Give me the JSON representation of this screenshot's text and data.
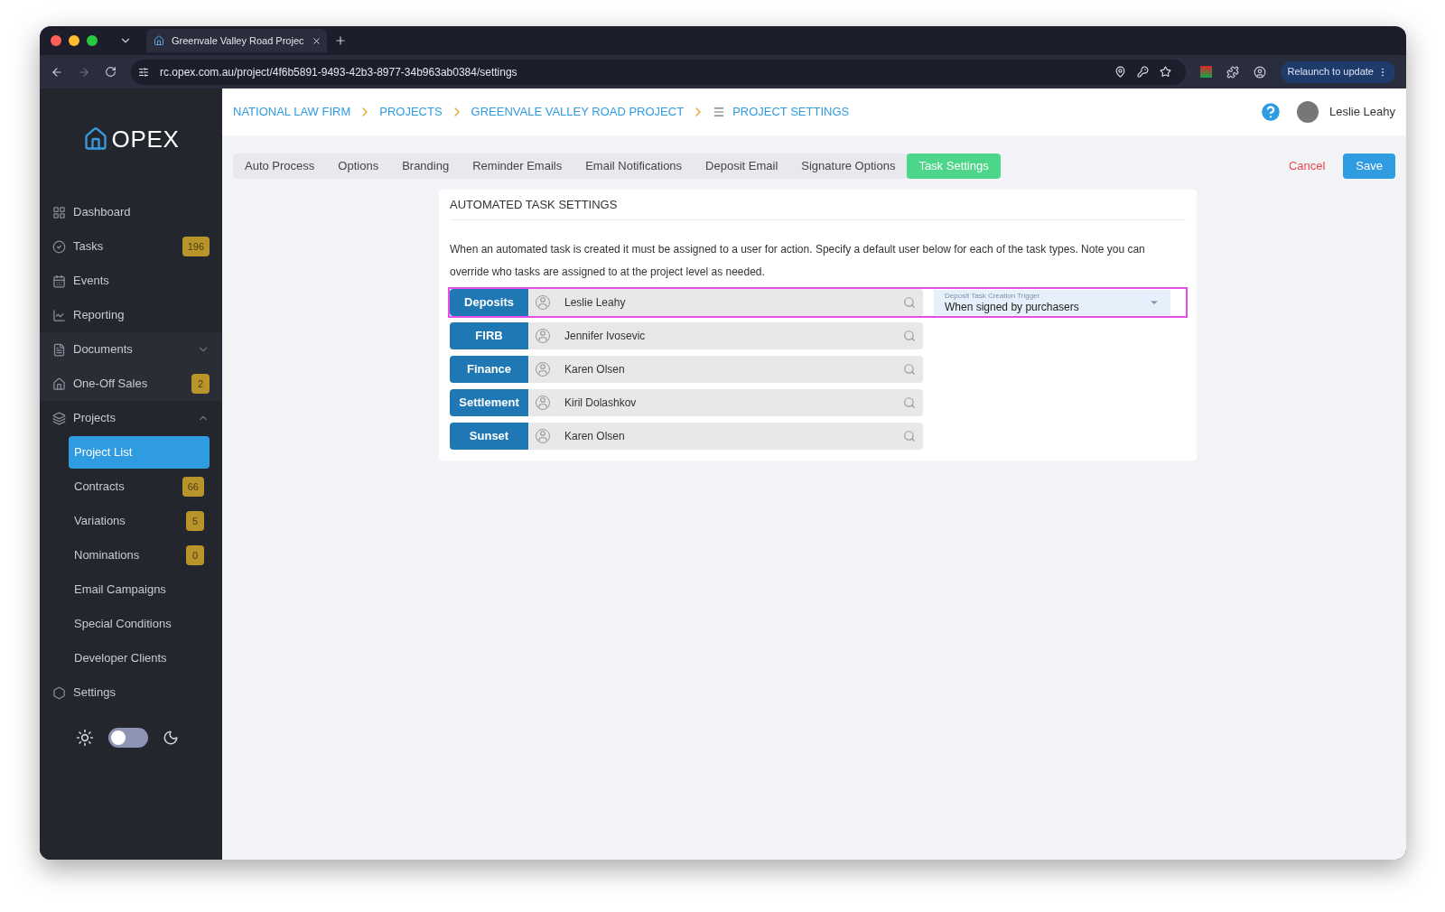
{
  "browser": {
    "tab_title": "Greenvale Valley Road Projec",
    "url": "rc.opex.com.au/project/4f6b5891-9493-42b3-8977-34b963ab0384/settings",
    "relaunch": "Relaunch to update"
  },
  "sidebar": {
    "logo": "OPEX",
    "items": [
      {
        "kind": "dashboard",
        "label": "Dashboard",
        "selected": false
      },
      {
        "kind": "tasks",
        "label": "Tasks",
        "badge": "196",
        "selected": false
      },
      {
        "kind": "events",
        "label": "Events",
        "selected": false
      },
      {
        "kind": "reporting",
        "label": "Reporting",
        "selected": false
      },
      {
        "kind": "documents",
        "label": "Documents",
        "expanded": false,
        "selected": false
      },
      {
        "kind": "sales",
        "label": "One-Off Sales",
        "badge": "2",
        "selected": false
      },
      {
        "kind": "projects",
        "label": "Projects",
        "expanded": true,
        "selected": false,
        "children": [
          {
            "label": "Project List",
            "selected": true
          },
          {
            "label": "Contracts",
            "badge": "66",
            "selected": false
          },
          {
            "label": "Variations",
            "badge": "5",
            "selected": false
          },
          {
            "label": "Nominations",
            "badge": "0",
            "selected": false
          },
          {
            "label": "Email Campaigns",
            "selected": false
          },
          {
            "label": "Special Conditions",
            "selected": false
          },
          {
            "label": "Developer Clients",
            "selected": false
          }
        ]
      },
      {
        "kind": "settings",
        "label": "Settings",
        "selected": false
      }
    ],
    "dark_mode": false
  },
  "breadcrumbs": [
    "NATIONAL LAW FIRM",
    "PROJECTS",
    "GREENVALE VALLEY ROAD PROJECT",
    "PROJECT SETTINGS"
  ],
  "user": {
    "name": "Leslie Leahy"
  },
  "tabs": [
    {
      "label": "Auto Process",
      "selected": false
    },
    {
      "label": "Options",
      "selected": false
    },
    {
      "label": "Branding",
      "selected": false
    },
    {
      "label": "Reminder Emails",
      "selected": false
    },
    {
      "label": "Email Notifications",
      "selected": false
    },
    {
      "label": "Deposit Email",
      "selected": false
    },
    {
      "label": "Signature Options",
      "selected": false
    },
    {
      "label": "Task Settings",
      "selected": true
    }
  ],
  "actions": {
    "cancel": "Cancel",
    "save": "Save"
  },
  "panel": {
    "title": "AUTOMATED TASK SETTINGS",
    "description": "When an automated task is created it must be assigned to a user for action. Specify a default user below for each of the task types. Note you can override who tasks are assigned to at the project level as needed.",
    "rows": [
      {
        "label": "Deposits",
        "assignee": "Leslie Leahy",
        "highlighted": true,
        "trigger": {
          "label": "Deposit Task Creation Trigger",
          "value": "When signed by purchasers"
        }
      },
      {
        "label": "FIRB",
        "assignee": "Jennifer  Ivosevic",
        "highlighted": false
      },
      {
        "label": "Finance",
        "assignee": "Karen Olsen",
        "highlighted": false
      },
      {
        "label": "Settlement",
        "assignee": "Kiril Dolashkov",
        "highlighted": false
      },
      {
        "label": "Sunset",
        "assignee": "Karen Olsen",
        "highlighted": false
      }
    ]
  }
}
